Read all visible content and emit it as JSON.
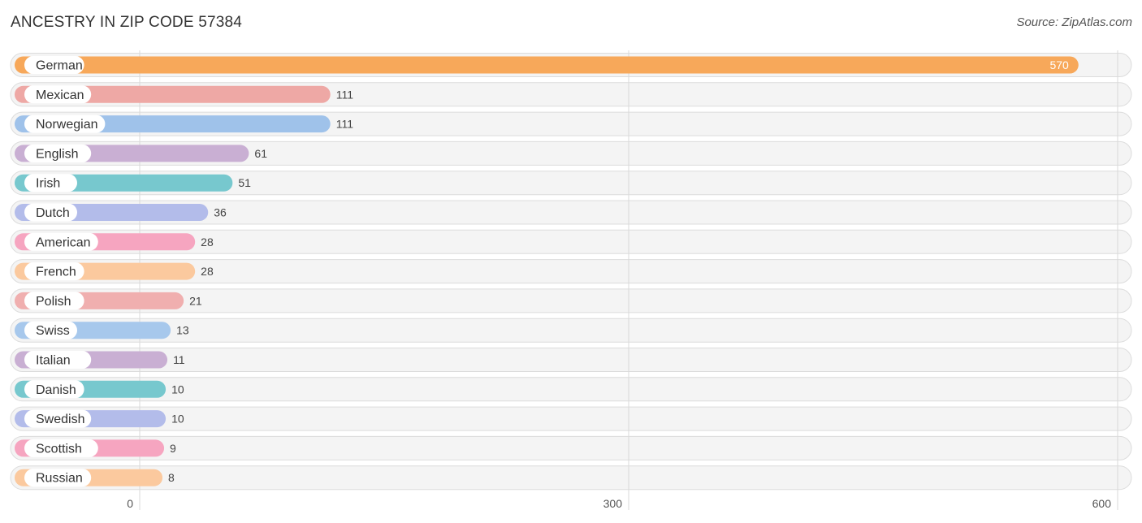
{
  "chart_data": {
    "type": "bar",
    "orientation": "horizontal",
    "title": "ANCESTRY IN ZIP CODE 57384",
    "source": "Source: ZipAtlas.com",
    "xlabel": "",
    "ylabel": "",
    "xlim": [
      0,
      600
    ],
    "ticks": [
      0,
      300,
      600
    ],
    "tick_labels": [
      "0",
      "300",
      "600"
    ],
    "grid": true,
    "categories": [
      "German",
      "Mexican",
      "Norwegian",
      "English",
      "Irish",
      "Dutch",
      "American",
      "French",
      "Polish",
      "Swiss",
      "Italian",
      "Danish",
      "Swedish",
      "Scottish",
      "Russian"
    ],
    "values": [
      570,
      111,
      111,
      61,
      51,
      36,
      28,
      28,
      21,
      13,
      11,
      10,
      10,
      9,
      8
    ],
    "colors": [
      "#f7a85a",
      "#eea8a5",
      "#9fc2ea",
      "#c9afd3",
      "#77c8ce",
      "#b3bcea",
      "#f6a5c0",
      "#fbc99e",
      "#f0afaf",
      "#a7c8ec",
      "#c9afd3",
      "#77c8ce",
      "#b3bcea",
      "#f6a5c0",
      "#fbc99e"
    ]
  }
}
